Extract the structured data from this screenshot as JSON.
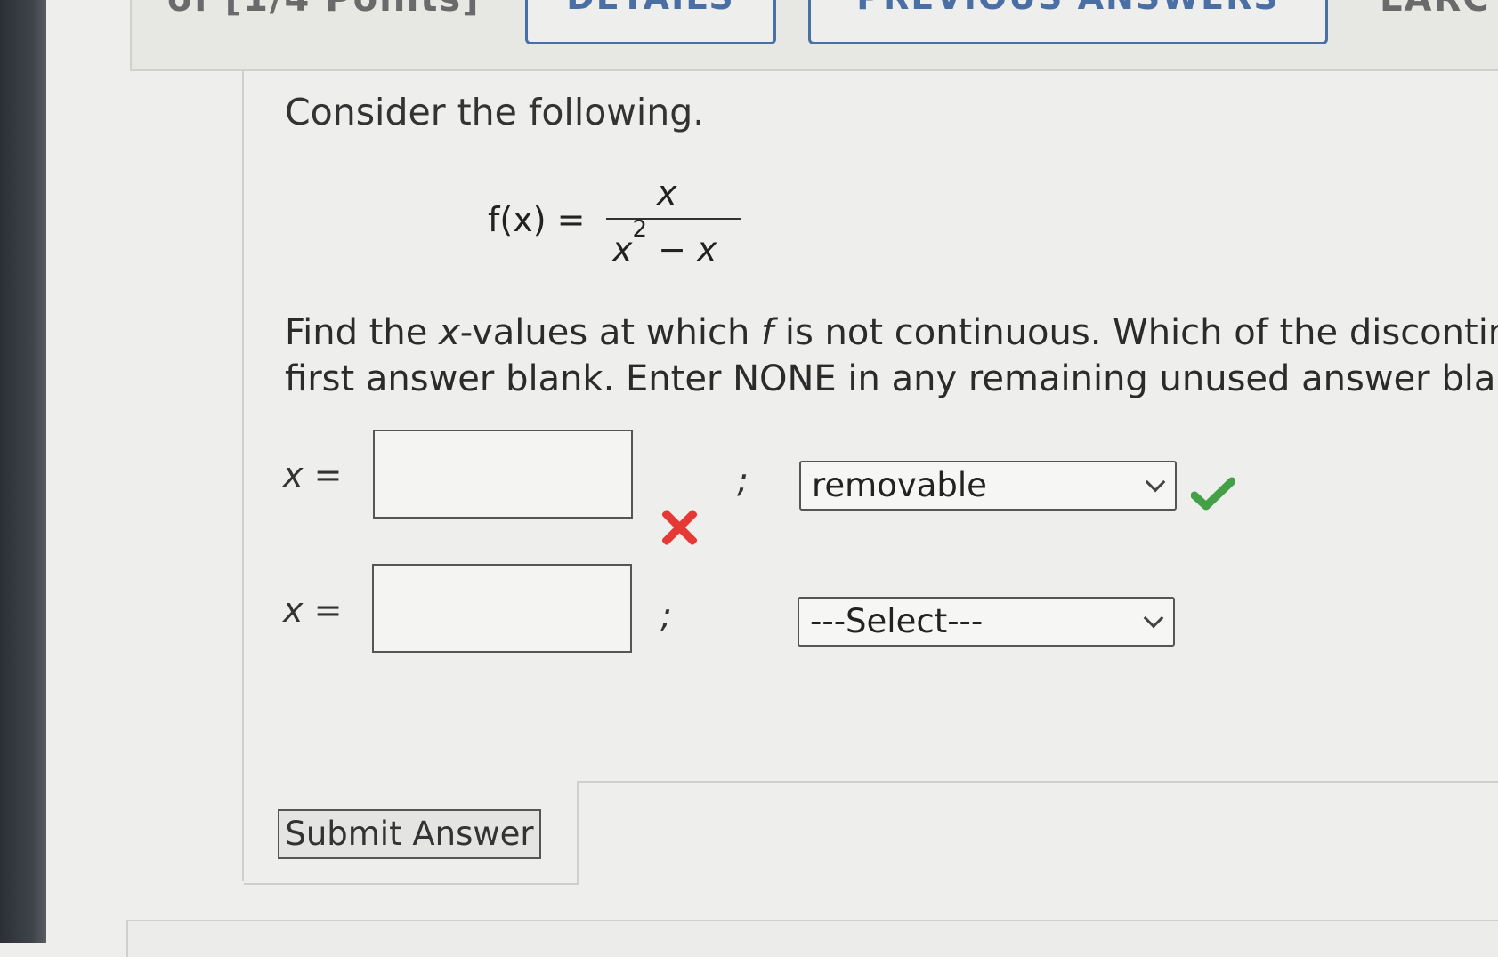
{
  "header": {
    "points_fragment": "of [1/4 Points]",
    "details_button": "DETAILS",
    "previous_answers_button": "PREVIOUS ANSWERS",
    "right_fragment": "LARC"
  },
  "problem": {
    "intro": "Consider the following.",
    "formula": {
      "lhs": "f(x) =",
      "numerator": "x",
      "denominator_base": "x",
      "denominator_exp": "2",
      "denominator_rest": " − x"
    },
    "question_line1_a": "Find the ",
    "question_line1_var": "x",
    "question_line1_b": "-values at which ",
    "question_line1_f": "f",
    "question_line1_c": " is not continuous. Which of the discontin",
    "question_line2": "first answer blank. Enter NONE in any remaining unused answer blan"
  },
  "answers": [
    {
      "label_var": "x",
      "label_eq": " =",
      "value": "",
      "semicolon": ";",
      "select_value": "removable",
      "input_status": "incorrect",
      "select_status": "correct"
    },
    {
      "label_var": "x",
      "label_eq": " =",
      "value": "",
      "semicolon": ";",
      "select_value": "---Select---"
    }
  ],
  "submit_label": "Submit Answer",
  "colors": {
    "incorrect": "#e53935",
    "correct": "#43a047",
    "accent": "#4a6fa5"
  }
}
